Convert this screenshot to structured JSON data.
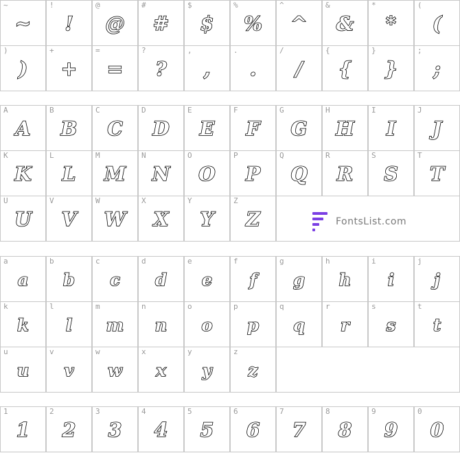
{
  "sections": [
    {
      "rows": [
        [
          [
            "~",
            "~"
          ],
          [
            "!",
            "!"
          ],
          [
            "@",
            "@"
          ],
          [
            "#",
            "#"
          ],
          [
            "$",
            "$"
          ],
          [
            "%",
            "%"
          ],
          [
            "^",
            "^"
          ],
          [
            "&",
            "&"
          ],
          [
            "*",
            "*"
          ],
          [
            "(",
            "("
          ]
        ],
        [
          [
            ")",
            ")"
          ],
          [
            "+",
            "+"
          ],
          [
            "=",
            "="
          ],
          [
            "?",
            "?"
          ],
          [
            ",",
            ","
          ],
          [
            ".",
            "."
          ],
          [
            "/",
            "/"
          ],
          [
            "{",
            "{"
          ],
          [
            "}",
            "}"
          ],
          [
            ";",
            ";"
          ]
        ]
      ]
    },
    {
      "rows": [
        [
          [
            "A",
            "A"
          ],
          [
            "B",
            "B"
          ],
          [
            "C",
            "C"
          ],
          [
            "D",
            "D"
          ],
          [
            "E",
            "E"
          ],
          [
            "F",
            "F"
          ],
          [
            "G",
            "G"
          ],
          [
            "H",
            "H"
          ],
          [
            "I",
            "I"
          ],
          [
            "J",
            "J"
          ]
        ],
        [
          [
            "K",
            "K"
          ],
          [
            "L",
            "L"
          ],
          [
            "M",
            "M"
          ],
          [
            "N",
            "N"
          ],
          [
            "O",
            "O"
          ],
          [
            "P",
            "P"
          ],
          [
            "Q",
            "Q"
          ],
          [
            "R",
            "R"
          ],
          [
            "S",
            "S"
          ],
          [
            "T",
            "T"
          ]
        ],
        [
          [
            "U",
            "U"
          ],
          [
            "V",
            "V"
          ],
          [
            "W",
            "W"
          ],
          [
            "X",
            "X"
          ],
          [
            "Y",
            "Y"
          ],
          [
            "Z",
            "Z"
          ]
        ]
      ]
    },
    {
      "rows": [
        [
          [
            "a",
            "a"
          ],
          [
            "b",
            "b"
          ],
          [
            "c",
            "c"
          ],
          [
            "d",
            "d"
          ],
          [
            "e",
            "e"
          ],
          [
            "f",
            "f"
          ],
          [
            "g",
            "g"
          ],
          [
            "h",
            "h"
          ],
          [
            "i",
            "i"
          ],
          [
            "j",
            "j"
          ]
        ],
        [
          [
            "k",
            "k"
          ],
          [
            "l",
            "l"
          ],
          [
            "m",
            "m"
          ],
          [
            "n",
            "n"
          ],
          [
            "o",
            "o"
          ],
          [
            "p",
            "p"
          ],
          [
            "q",
            "q"
          ],
          [
            "r",
            "r"
          ],
          [
            "s",
            "s"
          ],
          [
            "t",
            "t"
          ]
        ],
        [
          [
            "u",
            "u"
          ],
          [
            "v",
            "v"
          ],
          [
            "w",
            "w"
          ],
          [
            "x",
            "x"
          ],
          [
            "y",
            "y"
          ],
          [
            "z",
            "z"
          ]
        ]
      ]
    },
    {
      "rows": [
        [
          [
            "1",
            "1"
          ],
          [
            "2",
            "2"
          ],
          [
            "3",
            "3"
          ],
          [
            "4",
            "4"
          ],
          [
            "5",
            "5"
          ],
          [
            "6",
            "6"
          ],
          [
            "7",
            "7"
          ],
          [
            "8",
            "8"
          ],
          [
            "9",
            "9"
          ],
          [
            "0",
            "0"
          ]
        ]
      ]
    }
  ],
  "watermark": {
    "text": "FontsList.com",
    "accent_color": "#7b3fe4"
  }
}
